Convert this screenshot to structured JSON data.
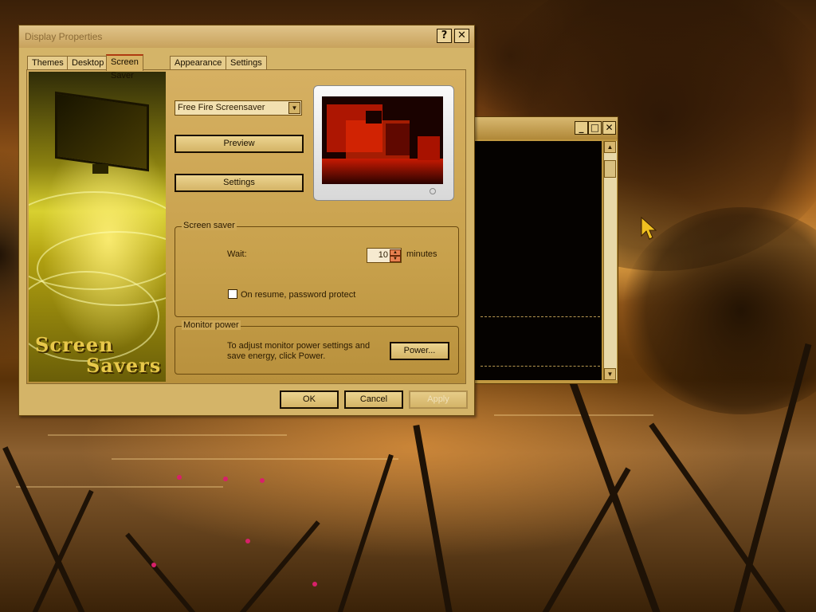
{
  "dialog": {
    "title": "Display Properties",
    "help_btn": "?",
    "close_btn": "✕",
    "tabs": [
      {
        "label": "Themes"
      },
      {
        "label": "Desktop"
      },
      {
        "label": "Screen Saver"
      },
      {
        "label": "Appearance"
      },
      {
        "label": "Settings"
      }
    ],
    "active_tab": "Screen Saver",
    "art": {
      "line1": "Screen",
      "line2": "Savers"
    },
    "screensaver_select": "Free Fire Screensaver",
    "preview_button": "Preview",
    "settings_button": "Settings",
    "screen_saver_group": {
      "legend": "Screen saver",
      "wait_label": "Wait:",
      "wait_value": "10",
      "minutes_label": "minutes",
      "password_label": "On resume, password protect",
      "password_checked": false
    },
    "monitor_power_group": {
      "legend": "Monitor power",
      "description": "To adjust monitor power settings and save energy, click Power.",
      "power_button": "Power..."
    },
    "ok_button": "OK",
    "cancel_button": "Cancel",
    "apply_button": "Apply"
  },
  "background_window": {
    "minimize": "_",
    "maximize": "□",
    "close": "✕"
  },
  "colors": {
    "accent": "#d4b468",
    "active_tab_border": "#b03a10",
    "flower": "#d8206a"
  }
}
